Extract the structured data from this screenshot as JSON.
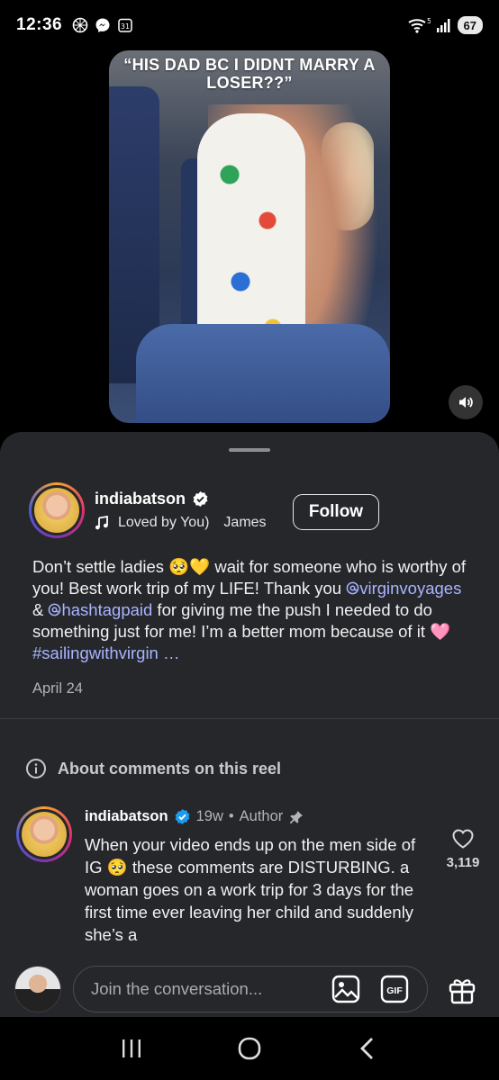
{
  "status_bar": {
    "time": "12:36",
    "calendar_badge": "31",
    "wifi_label": "5",
    "battery": "67"
  },
  "video": {
    "caption": "“HIS DAD BC I DIDNT MARRY A LOSER??”"
  },
  "post": {
    "author": "indiabatson",
    "song": "Loved by You)",
    "song_next": "James",
    "follow_label": "Follow",
    "caption_segments": [
      {
        "type": "text",
        "text": "Don’t settle ladies 🥺💛 wait for someone who is worthy of you! Best work trip of my LIFE! Thank you "
      },
      {
        "type": "mention",
        "text": "virginvoyages"
      },
      {
        "type": "text",
        "text": " & "
      },
      {
        "type": "mention",
        "text": "hashtagpaid"
      },
      {
        "type": "text",
        "text": " for giving me the push I needed to do something just for me! I’m a better mom because of it 🩷 "
      },
      {
        "type": "tag",
        "text": "#sailingwithvirgin …"
      }
    ],
    "date": "April 24"
  },
  "comments_section": {
    "about_label": "About comments on this reel"
  },
  "comment": {
    "author": "indiabatson",
    "age": "19w",
    "separator": "•",
    "role": "Author",
    "text": "When your video ends up on the men side of IG 🥺 these comments are DISTURBING. a woman goes on a work trip for 3 days for the first time ever leaving her child and suddenly she’s a",
    "likes": "3,119"
  },
  "composer": {
    "placeholder": "Join the conversation...",
    "gif_label": "GIF"
  },
  "icons": {
    "music": "music-note-icon",
    "verified": "verified-badge-icon",
    "info": "info-icon",
    "pin": "pin-icon",
    "heart": "heart-icon",
    "image": "image-icon",
    "gift": "gift-icon",
    "mute": "speaker-icon"
  },
  "colors": {
    "sheet_bg": "#25272b",
    "mention": "#a9b4ff",
    "verified_blue": "#1d9bf0"
  }
}
